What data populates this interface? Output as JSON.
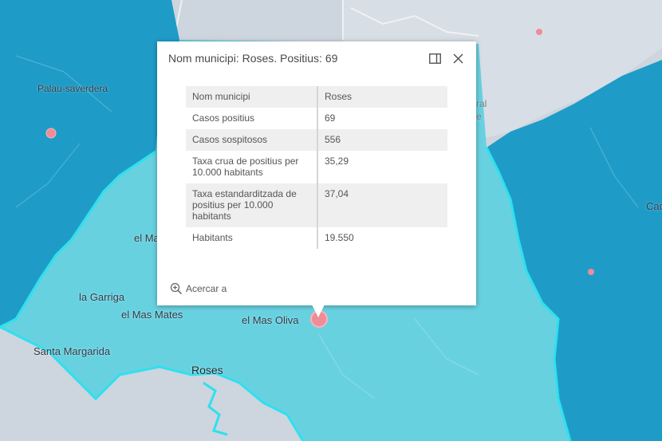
{
  "map": {
    "colors": {
      "dark_region": "#1e9cc7",
      "light_region": "#68d1e0",
      "land_gray": "#cdd5de",
      "border": "#2fe0ef",
      "point": "#ef8c96"
    },
    "places": [
      "Palau-saverdera",
      "el Ma",
      "la Garriga",
      "el Mas Mates",
      "el Mas Oliva",
      "Santa Margarida",
      "Roses",
      "ral",
      "e",
      "Cad"
    ]
  },
  "popup": {
    "title": "Nom municipi: Roses. Positius: 69",
    "dock_icon": "dock-icon",
    "close_icon": "close-icon",
    "rows": [
      {
        "key": "Nom municipi",
        "value": "Roses"
      },
      {
        "key": "Casos positius",
        "value": "69"
      },
      {
        "key": "Casos sospitosos",
        "value": "556"
      },
      {
        "key": "Taxa crua de positius per 10.000 habitants",
        "value": "35,29"
      },
      {
        "key": "Taxa estandarditzada de positius per 10.000 habitants",
        "value": "37,04"
      },
      {
        "key": "Habitants",
        "value": "19.550"
      }
    ],
    "zoom_label": "Acercar a",
    "zoom_icon": "zoom-in-icon"
  }
}
